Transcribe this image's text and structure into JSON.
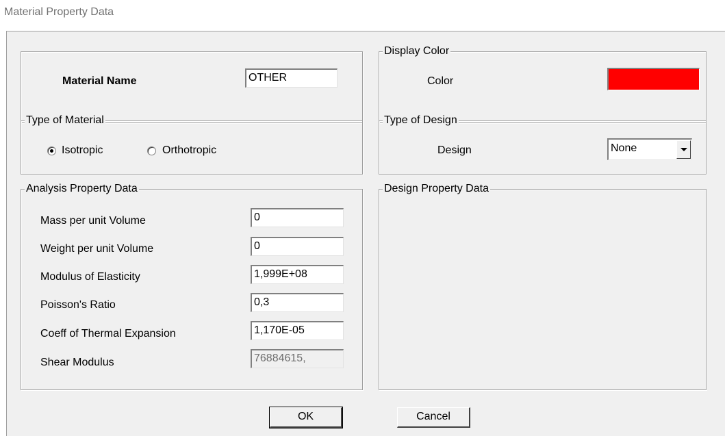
{
  "window": {
    "title": "Material Property Data"
  },
  "material_name": {
    "label": "Material Name",
    "value": "OTHER"
  },
  "display_color": {
    "legend": "Display Color",
    "label": "Color",
    "color": "#ff0000"
  },
  "type_of_material": {
    "legend": "Type of Material",
    "options": [
      {
        "label": "Isotropic",
        "checked": true
      },
      {
        "label": "Orthotropic",
        "checked": false
      }
    ]
  },
  "type_of_design": {
    "legend": "Type of Design",
    "label": "Design",
    "selected": "None"
  },
  "analysis_property_data": {
    "legend": "Analysis Property Data",
    "fields": [
      {
        "label": "Mass per unit Volume",
        "value": "0",
        "editable": true
      },
      {
        "label": "Weight per unit Volume",
        "value": "0",
        "editable": true
      },
      {
        "label": "Modulus of Elasticity",
        "value": "1,999E+08",
        "editable": true
      },
      {
        "label": "Poisson's Ratio",
        "value": "0,3",
        "editable": true
      },
      {
        "label": "Coeff of Thermal Expansion",
        "value": "1,170E-05",
        "editable": true
      },
      {
        "label": "Shear Modulus",
        "value": "76884615,",
        "editable": false
      }
    ]
  },
  "design_property_data": {
    "legend": "Design Property Data"
  },
  "buttons": {
    "ok": "OK",
    "cancel": "Cancel"
  }
}
